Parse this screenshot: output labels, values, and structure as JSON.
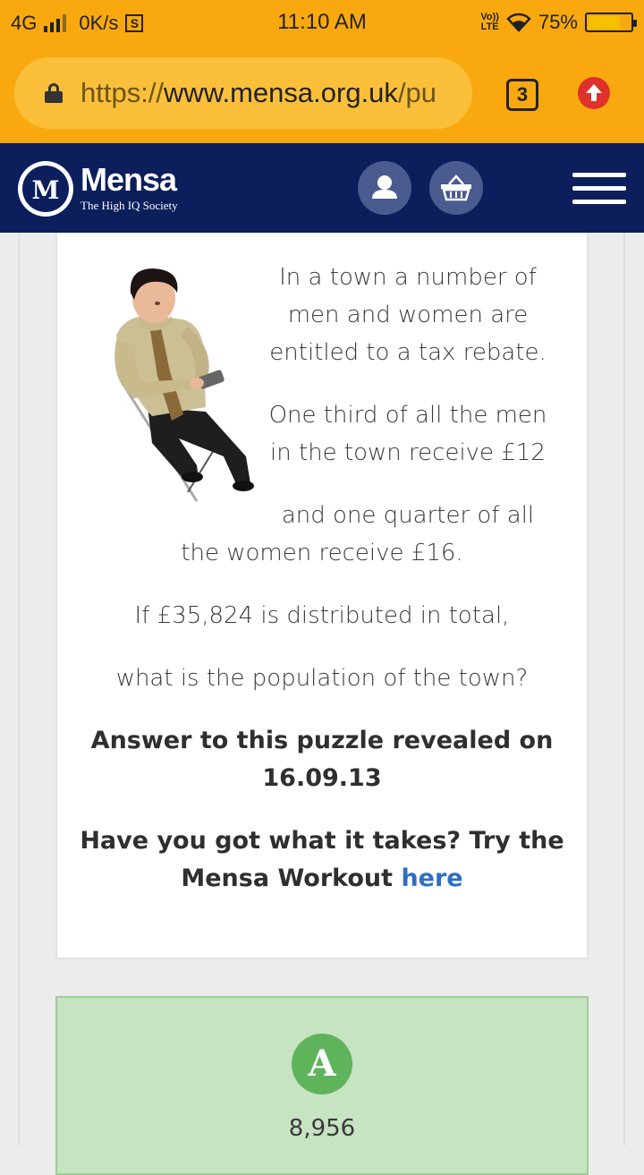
{
  "status_bar": {
    "network": "4G",
    "speed": "0K/s",
    "s_badge": "S",
    "time": "11:10 AM",
    "volte_top": "Vo))",
    "volte_bottom": "LTE",
    "battery": "75%",
    "battery_level": 0.75,
    "battery_color": "#f4c000"
  },
  "browser": {
    "url_scheme": "https://",
    "url_host": "www.mensa.org.uk",
    "url_rest": "/pu",
    "tab_count": "3",
    "toolbar_color": "#f9a90f",
    "upload_icon": "arrow-up-icon",
    "upload_color": "#e0312a"
  },
  "site_header": {
    "logo_letter": "M",
    "brand_name": "Mensa",
    "tagline": "The High IQ Society",
    "background": "#0c1f5c",
    "account_icon": "user-icon",
    "basket_icon": "basket-icon",
    "menu_icon": "hamburger-menu-icon"
  },
  "puzzle": {
    "illustration_icon": "man-with-phone-illustration",
    "line1": "In a town a number of",
    "line2": "men and women are",
    "line3": "entitled to a tax rebate.",
    "line4": "One third of all the men",
    "line5": "in the town receive £12",
    "line6": "and one quarter of all",
    "line7": "the women receive £16.",
    "line8": "If £35,824 is distributed in total,",
    "line9": "what is the population of the town?",
    "reveal_line1": "Answer to this puzzle revealed on",
    "reveal_line2": "16.09.13",
    "cta_line1": "Have you got what it takes? Try the",
    "cta_line2": "Mensa Workout ",
    "cta_link": "here",
    "link_color": "#2e6fc0"
  },
  "answer": {
    "badge": "A",
    "value": "8,956",
    "box_color": "#c6e3c2",
    "badge_color": "#5fb45b"
  }
}
